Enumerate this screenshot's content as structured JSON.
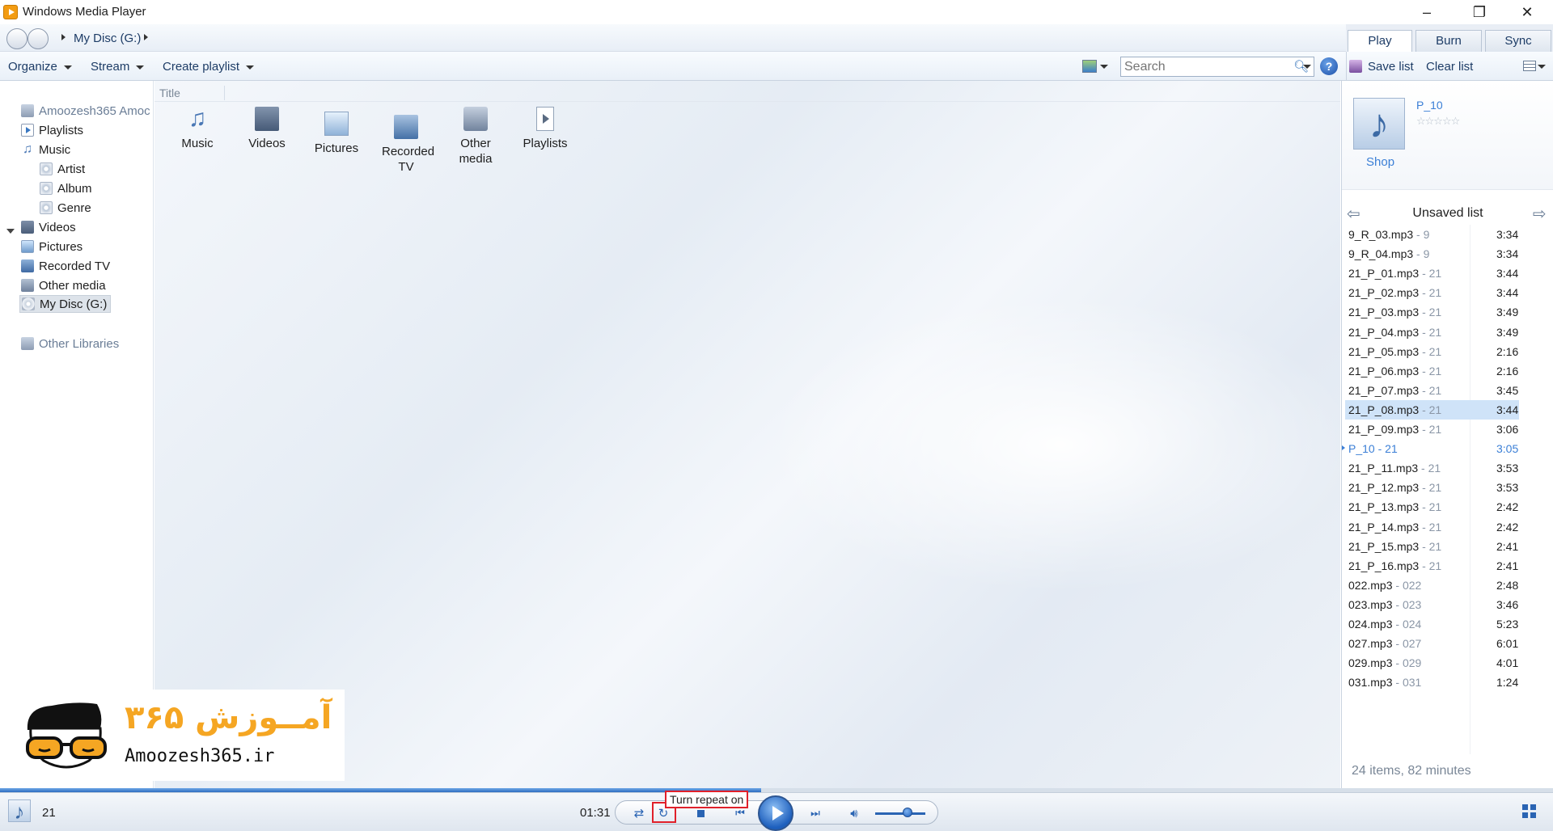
{
  "window": {
    "title": "Windows Media Player"
  },
  "navbar": {
    "breadcrumb": "My Disc (G:)"
  },
  "toolbar": {
    "organize": "Organize",
    "stream": "Stream",
    "create_playlist": "Create playlist",
    "search_placeholder": "Search"
  },
  "right_tabs": [
    {
      "label": "Play",
      "active": true
    },
    {
      "label": "Burn",
      "active": false
    },
    {
      "label": "Sync",
      "active": false
    }
  ],
  "right_toolbar": {
    "save_list": "Save list",
    "clear_list": "Clear list"
  },
  "left_nav": [
    {
      "label": "Amoozesh365 Amoc",
      "level": 0,
      "icon": "library-icon"
    },
    {
      "label": "Playlists",
      "level": 1,
      "icon": "playlist-icon"
    },
    {
      "label": "Music",
      "level": 1,
      "icon": "music-note-icon"
    },
    {
      "label": "Artist",
      "level": 2,
      "icon": "artist-icon"
    },
    {
      "label": "Album",
      "level": 2,
      "icon": "album-icon"
    },
    {
      "label": "Genre",
      "level": 2,
      "icon": "genre-icon"
    },
    {
      "label": "Videos",
      "level": 1,
      "icon": "video-icon"
    },
    {
      "label": "Pictures",
      "level": 1,
      "icon": "picture-icon"
    },
    {
      "label": "Recorded TV",
      "level": 1,
      "icon": "tv-icon"
    },
    {
      "label": "Other media",
      "level": 1,
      "icon": "other-media-icon"
    },
    {
      "label": "My Disc (G:)",
      "level": 1,
      "icon": "disc-icon",
      "selected": true
    },
    {
      "label": "Other Libraries",
      "level": 0,
      "icon": "other-libraries-icon"
    }
  ],
  "main": {
    "column_header": "Title",
    "tiles": [
      {
        "label": "Music",
        "icon": "music-note-icon"
      },
      {
        "label": "Videos",
        "icon": "video-icon"
      },
      {
        "label": "Pictures",
        "icon": "picture-icon"
      },
      {
        "label": "Recorded TV",
        "icon": "tv-icon"
      },
      {
        "label": "Other media",
        "icon": "other-media-icon"
      },
      {
        "label": "Playlists",
        "icon": "playlist-icon"
      }
    ]
  },
  "now_playing": {
    "title": "P_10",
    "shop": "Shop",
    "rating_stars": 0
  },
  "playlist": {
    "title": "Unsaved list",
    "items": [
      {
        "name": "9_R_03.mp3",
        "album": "9",
        "duration": "3:34"
      },
      {
        "name": "9_R_04.mp3",
        "album": "9",
        "duration": "3:34"
      },
      {
        "name": "21_P_01.mp3",
        "album": "21",
        "duration": "3:44"
      },
      {
        "name": "21_P_02.mp3",
        "album": "21",
        "duration": "3:44"
      },
      {
        "name": "21_P_03.mp3",
        "album": "21",
        "duration": "3:49"
      },
      {
        "name": "21_P_04.mp3",
        "album": "21",
        "duration": "3:49"
      },
      {
        "name": "21_P_05.mp3",
        "album": "21",
        "duration": "2:16"
      },
      {
        "name": "21_P_06.mp3",
        "album": "21",
        "duration": "2:16"
      },
      {
        "name": "21_P_07.mp3",
        "album": "21",
        "duration": "3:45"
      },
      {
        "name": "21_P_08.mp3",
        "album": "21",
        "duration": "3:44",
        "selected": true
      },
      {
        "name": "21_P_09.mp3",
        "album": "21",
        "duration": "3:06"
      },
      {
        "name": "P_10",
        "album": "21",
        "duration": "3:05",
        "current": true
      },
      {
        "name": "21_P_11.mp3",
        "album": "21",
        "duration": "3:53"
      },
      {
        "name": "21_P_12.mp3",
        "album": "21",
        "duration": "3:53"
      },
      {
        "name": "21_P_13.mp3",
        "album": "21",
        "duration": "2:42"
      },
      {
        "name": "21_P_14.mp3",
        "album": "21",
        "duration": "2:42"
      },
      {
        "name": "21_P_15.mp3",
        "album": "21",
        "duration": "2:41"
      },
      {
        "name": "21_P_16.mp3",
        "album": "21",
        "duration": "2:41"
      },
      {
        "name": "022.mp3",
        "album": "022",
        "duration": "2:48"
      },
      {
        "name": "023.mp3",
        "album": "023",
        "duration": "3:46"
      },
      {
        "name": "024.mp3",
        "album": "024",
        "duration": "5:23"
      },
      {
        "name": "027.mp3",
        "album": "027",
        "duration": "6:01"
      },
      {
        "name": "029.mp3",
        "album": "029",
        "duration": "4:01"
      },
      {
        "name": "031.mp3",
        "album": "031",
        "duration": "1:24"
      }
    ],
    "summary": "24 items, 82 minutes"
  },
  "player": {
    "track": "21",
    "elapsed": "01:31",
    "progress": 0.49,
    "volume": 0.6,
    "tooltip": "Turn repeat on"
  },
  "logo": {
    "fa_text": "آمــوزش ۳۶۵",
    "site": "Amoozesh365.ir"
  },
  "colors": {
    "accent": "#2a64b3",
    "selection": "#cfe3f8",
    "highlight": "#e0202a"
  }
}
